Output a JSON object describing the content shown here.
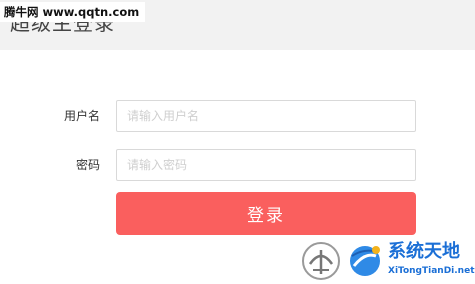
{
  "header": {
    "title": "超级主登录"
  },
  "watermark": {
    "site": "腾牛网 www.qqtn.com"
  },
  "form": {
    "username_label": "用户名",
    "username_placeholder": "请输入用户名",
    "username_value": "",
    "password_label": "密码",
    "password_placeholder": "请输入密码",
    "password_value": "",
    "login_label": "登录"
  },
  "brand": {
    "name": "系统天地",
    "url": "XiTongTianDi.net"
  },
  "colors": {
    "header_bg": "#f2f2f2",
    "button_bg": "#fa5f5e",
    "brand_blue": "#1b6fd6"
  }
}
